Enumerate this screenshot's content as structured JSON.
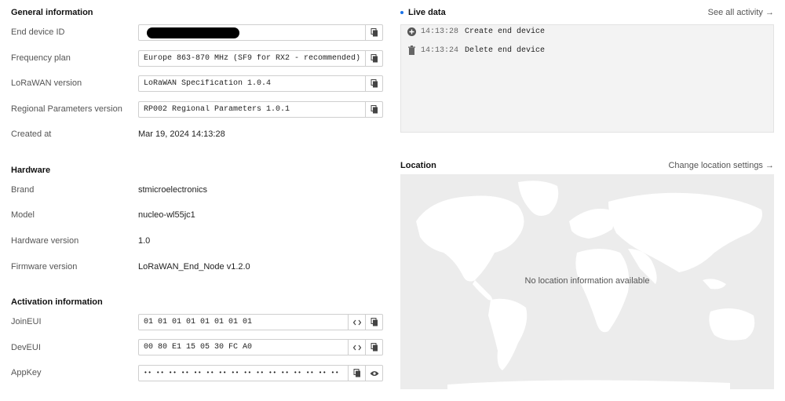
{
  "general": {
    "title": "General information",
    "rows": [
      {
        "label": "End device ID",
        "value": ""
      },
      {
        "label": "Frequency plan",
        "value": "Europe 863-870 MHz (SF9 for RX2 - recommended)"
      },
      {
        "label": "LoRaWAN version",
        "value": "LoRaWAN Specification 1.0.4"
      },
      {
        "label": "Regional Parameters version",
        "value": "RP002 Regional Parameters 1.0.1"
      },
      {
        "label": "Created at",
        "value": "Mar 19, 2024 14:13:28"
      }
    ]
  },
  "hardware": {
    "title": "Hardware",
    "rows": [
      {
        "label": "Brand",
        "value": "stmicroelectronics"
      },
      {
        "label": "Model",
        "value": "nucleo-wl55jc1"
      },
      {
        "label": "Hardware version",
        "value": "1.0"
      },
      {
        "label": "Firmware version",
        "value": "LoRaWAN_End_Node v1.2.0"
      }
    ]
  },
  "activation": {
    "title": "Activation information",
    "rows": [
      {
        "label": "JoinEUI",
        "value": "01 01 01 01 01 01 01 01"
      },
      {
        "label": "DevEUI",
        "value": "00 80 E1 15 05 30 FC A0"
      },
      {
        "label": "AppKey",
        "value": "•• •• •• •• •• •• •• •• •• •• •• •• •• •• •• ••"
      }
    ]
  },
  "live_data": {
    "title": "Live data",
    "see_all": "See all activity →",
    "events": [
      {
        "time": "14:13:28",
        "event": "Create end device",
        "icon": "plus-circle-icon"
      },
      {
        "time": "14:13:24",
        "event": "Delete end device",
        "icon": "trash-icon"
      }
    ]
  },
  "location": {
    "title": "Location",
    "change_link": "Change location settings →",
    "message": "No location information available"
  },
  "colors": {
    "accent": "#1a73e8",
    "map_bg": "#ececec",
    "land": "#ffffff"
  }
}
